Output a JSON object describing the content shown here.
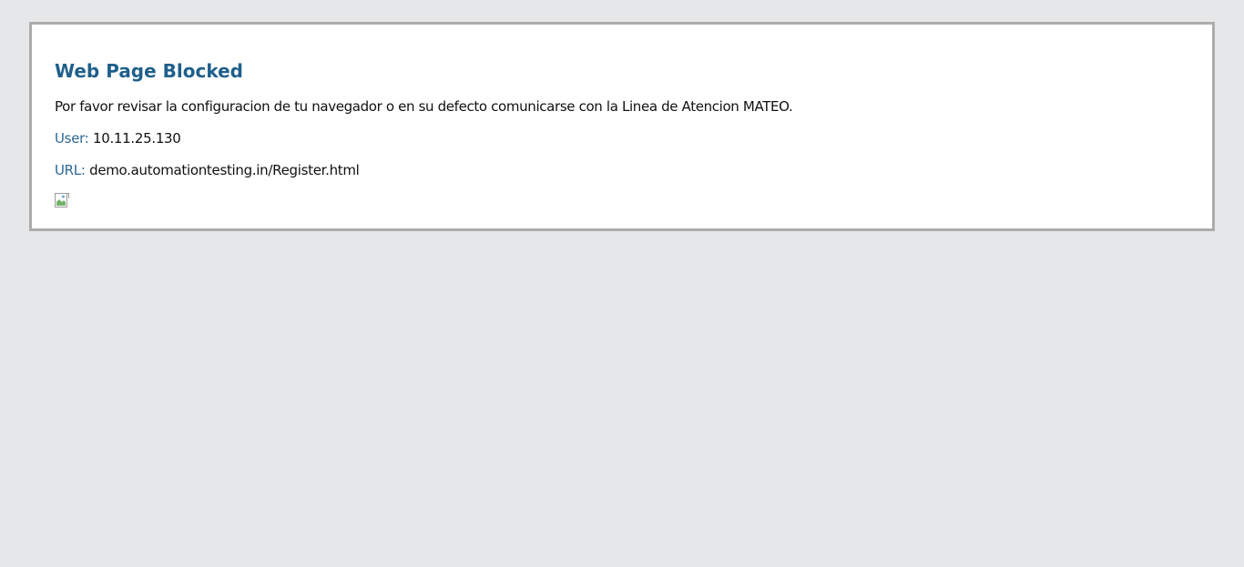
{
  "page": {
    "title": "Web Page Blocked",
    "message": "Por favor revisar la configuracion de tu navegador o en su defecto comunicarse con la Linea de Atencion MATEO.",
    "user": {
      "label": "User:",
      "value": "10.11.25.130"
    },
    "url": {
      "label": "URL:",
      "value": "demo.automationtesting.in/Register.html"
    },
    "image_icon": "broken-image-icon"
  },
  "colors": {
    "background": "#e6e7e8",
    "panel": "#ffffff",
    "panel_border": "#acacac",
    "title": "#1f5f8b",
    "label": "#2d6a96",
    "text": "#111111"
  }
}
